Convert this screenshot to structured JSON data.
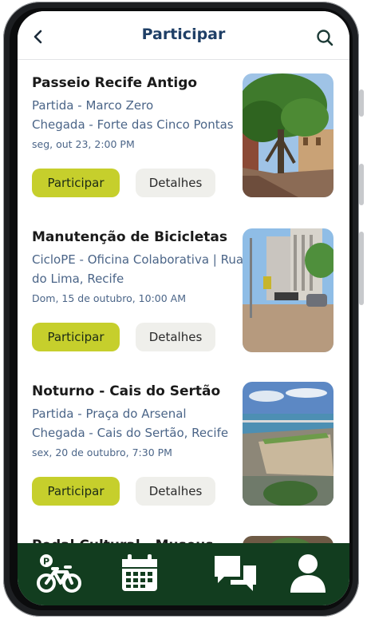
{
  "header": {
    "title": "Participar"
  },
  "events": [
    {
      "title": "Passeio Recife Antigo",
      "line1": "Partida - Marco Zero",
      "line2": "Chegada - Forte das Cinco Pontas",
      "date": "seg, out 23, 2:00 PM",
      "join_label": "Participar",
      "details_label": "Detalhes"
    },
    {
      "title": "Manutenção de Bicicletas",
      "line1": "CicloPE - Oficina Colaborativa | Rua",
      "line2": "do Lima, Recife",
      "date": "Dom, 15 de outubro, 10:00 AM",
      "join_label": "Participar",
      "details_label": "Detalhes"
    },
    {
      "title": "Noturno - Cais do Sertão",
      "line1": "Partida - Praça do Arsenal",
      "line2": "Chegada - Cais do Sertão, Recife",
      "date": "sex, 20 de outubro, 7:30 PM",
      "join_label": "Participar",
      "details_label": "Detalhes"
    },
    {
      "title": "Pedal Cultural - Museus"
    }
  ],
  "nav": {
    "items": [
      "bike-parking-icon",
      "calendar-icon",
      "chat-icon",
      "profile-icon"
    ]
  },
  "colors": {
    "accent": "#c6cf2c",
    "title": "#1f3f66",
    "nav_bg": "#123d1f",
    "meta_text": "#4b6588"
  }
}
